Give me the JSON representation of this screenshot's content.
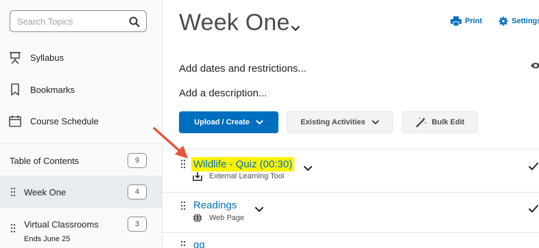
{
  "sidebar": {
    "search": {
      "placeholder": "Search Topics",
      "value": ""
    },
    "items": [
      {
        "label": "Syllabus",
        "icon": "presentation-icon"
      },
      {
        "label": "Bookmarks",
        "icon": "bookmark-icon"
      },
      {
        "label": "Course Schedule",
        "icon": "calendar-icon"
      }
    ],
    "toc": {
      "label": "Table of Contents",
      "count": "9"
    },
    "modules": [
      {
        "label": "Week One",
        "count": "4",
        "selected": true
      },
      {
        "label": "Virtual Classrooms",
        "count": "3",
        "sub": "Ends June 25",
        "selected": false
      }
    ]
  },
  "main": {
    "title": "Week One",
    "actions": {
      "print": "Print",
      "settings": "Settings"
    },
    "add_dates": "Add dates and restrictions...",
    "add_description": "Add a description...",
    "buttons": {
      "upload_create": "Upload / Create",
      "existing_activities": "Existing Activities",
      "bulk_edit": "Bulk Edit"
    },
    "items": [
      {
        "title": "Wildlife - Quiz (00:30)",
        "type": "External Learning Tool",
        "highlighted": true
      },
      {
        "title": "Readings",
        "type": "Web Page",
        "highlighted": false
      },
      {
        "title": "gg",
        "type": "",
        "highlighted": false
      }
    ]
  },
  "colors": {
    "accent": "#006fbf",
    "highlight": "#fff200",
    "annotation_arrow": "#e8553d",
    "sidebar_bg": "#f9fafb",
    "selected_bg": "#e9ecef"
  }
}
